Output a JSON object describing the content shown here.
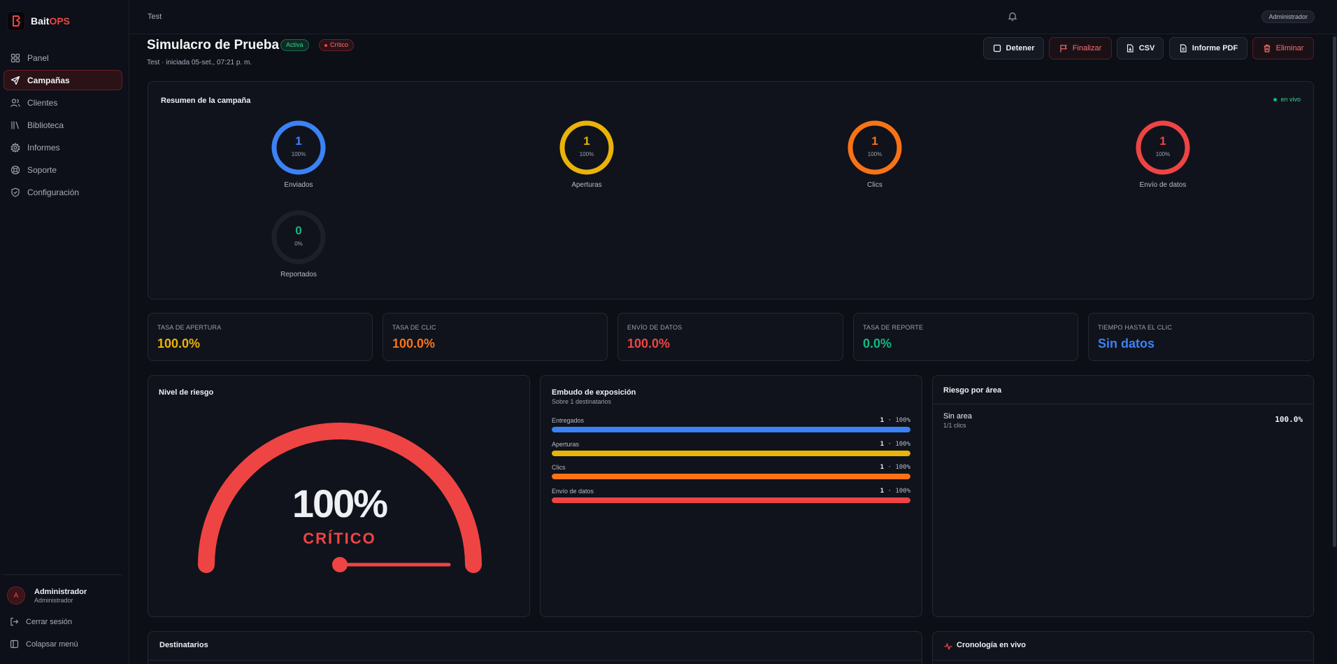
{
  "app": {
    "brand_a": "Bait",
    "brand_b": "OPS",
    "accent": "#ef4444"
  },
  "sidebar": {
    "items": [
      {
        "label": "Panel",
        "icon": "grid-icon"
      },
      {
        "label": "Campañas",
        "icon": "send-icon",
        "active": true
      },
      {
        "label": "Clientes",
        "icon": "users-icon"
      },
      {
        "label": "Biblioteca",
        "icon": "library-icon"
      },
      {
        "label": "Informes",
        "icon": "gear-icon"
      },
      {
        "label": "Soporte",
        "icon": "lifebuoy-icon"
      },
      {
        "label": "Configuración",
        "icon": "shield-icon"
      }
    ],
    "user": {
      "initial": "A",
      "name": "Administrador",
      "role": "Administrador"
    },
    "logout": "Cerrar sesión",
    "collapse": "Colapsar menú"
  },
  "topbar": {
    "breadcrumb": "Test",
    "user_pill": "Administrador"
  },
  "header": {
    "title": "Simulacro de Prueba",
    "badge_status": "Activa",
    "badge_risk": "Crítico",
    "subtitle": "Test · iniciada 05-set., 07:21 p. m.",
    "actions": {
      "stop": "Detener",
      "finish": "Finalizar",
      "csv": "CSV",
      "pdf": "Informe PDF",
      "delete": "Eliminar"
    }
  },
  "summary": {
    "title": "Resumen de la campaña",
    "live": "en vivo",
    "metrics": [
      {
        "value": "1",
        "percent": "100%",
        "fraction": 1,
        "label": "Enviados",
        "color": "#3b82f6"
      },
      {
        "value": "1",
        "percent": "100%",
        "fraction": 1,
        "label": "Aperturas",
        "color": "#eab308"
      },
      {
        "value": "1",
        "percent": "100%",
        "fraction": 1,
        "label": "Clics",
        "color": "#f97316"
      },
      {
        "value": "1",
        "percent": "100%",
        "fraction": 1,
        "label": "Envío de datos",
        "color": "#ef4444"
      },
      {
        "value": "0",
        "percent": "0%",
        "fraction": 0,
        "label": "Reportados",
        "color": "#10b981"
      }
    ]
  },
  "stats": [
    {
      "label": "TASA DE APERTURA",
      "value": "100.0%",
      "color": "#eab308"
    },
    {
      "label": "TASA DE CLIC",
      "value": "100.0%",
      "color": "#f97316"
    },
    {
      "label": "ENVÍO DE DATOS",
      "value": "100.0%",
      "color": "#ef4444"
    },
    {
      "label": "TASA DE REPORTE",
      "value": "0.0%",
      "color": "#10b981"
    },
    {
      "label": "TIEMPO HASTA EL CLIC",
      "value": "Sin datos",
      "color": "#3b82f6"
    }
  ],
  "risk": {
    "title": "Nivel de riesgo",
    "value": "100%",
    "level": "CRÍTICO",
    "fraction": 1,
    "color": "#ef4444"
  },
  "funnel": {
    "title": "Embudo de exposición",
    "subtitle": "Sobre 1 destinatarios",
    "rows": [
      {
        "label": "Entregados",
        "count": "1",
        "percent": "100%",
        "fraction": 1,
        "color": "#3b82f6"
      },
      {
        "label": "Aperturas",
        "count": "1",
        "percent": "100%",
        "fraction": 1,
        "color": "#eab308"
      },
      {
        "label": "Clics",
        "count": "1",
        "percent": "100%",
        "fraction": 1,
        "color": "#f97316"
      },
      {
        "label": "Envío de datos",
        "count": "1",
        "percent": "100%",
        "fraction": 1,
        "color": "#ef4444"
      }
    ]
  },
  "area_risk": {
    "title": "Riesgo por área",
    "name": "Sin area",
    "sub": "1/1 clics",
    "value": "100.0%"
  },
  "recipients": {
    "title": "Destinatarios"
  },
  "timeline": {
    "title": "Cronología en vivo"
  }
}
